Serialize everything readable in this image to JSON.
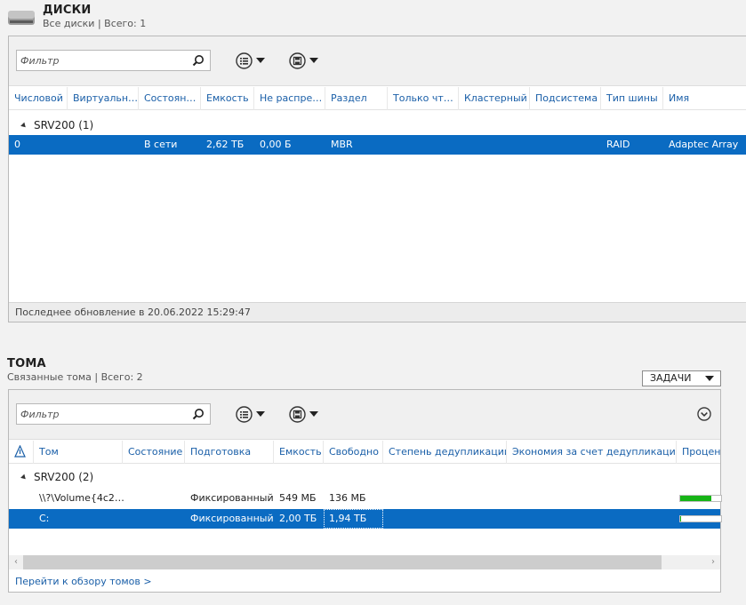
{
  "disks": {
    "title": "ДИСКИ",
    "subtitle": "Все диски | Всего: 1",
    "filter_placeholder": "Фильтр",
    "columns": [
      "Числовой",
      "Виртуальн…",
      "Состоян…",
      "Емкость",
      "Не распре…",
      "Раздел",
      "Только чт…",
      "Кластерный",
      "Подсистема",
      "Тип шины",
      "Имя"
    ],
    "group": "SRV200 (1)",
    "rows": [
      {
        "number": "0",
        "virtual": "",
        "status": "В сети",
        "capacity": "2,62 ТБ",
        "unallocated": "0,00 Б",
        "partition": "MBR",
        "readonly": "",
        "clustered": "",
        "subsystem": "",
        "bus": "RAID",
        "name": "Adaptec Array"
      }
    ],
    "status": "Последнее обновление в 20.06.2022 15:29:47"
  },
  "volumes": {
    "title": "ТОМА",
    "subtitle": "Связанные тома | Всего: 2",
    "tasks_label": "ЗАДАЧИ",
    "filter_placeholder": "Фильтр",
    "columns": [
      "Том",
      "Состояние",
      "Подготовка",
      "Емкость",
      "Свободно",
      "Степень дедупликации",
      "Экономия за счет дедупликации",
      "Процен"
    ],
    "group": "SRV200 (2)",
    "rows": [
      {
        "volume": "\\\\?\\Volume{4c2…",
        "status": "",
        "provisioning": "Фиксированный",
        "capacity": "549 МБ",
        "free": "136 МБ",
        "dedup": "",
        "savings": "",
        "used_fraction": 0.75
      },
      {
        "volume": "C:",
        "status": "",
        "provisioning": "Фиксированный",
        "capacity": "2,00 ТБ",
        "free": "1,94 ТБ",
        "dedup": "",
        "savings": "",
        "used_fraction": 0.03
      }
    ],
    "link": "Перейти к обзору томов >"
  },
  "colors": {
    "accent": "#0a6bc2",
    "link": "#1a5fa8",
    "bar_green": "#16b416"
  }
}
